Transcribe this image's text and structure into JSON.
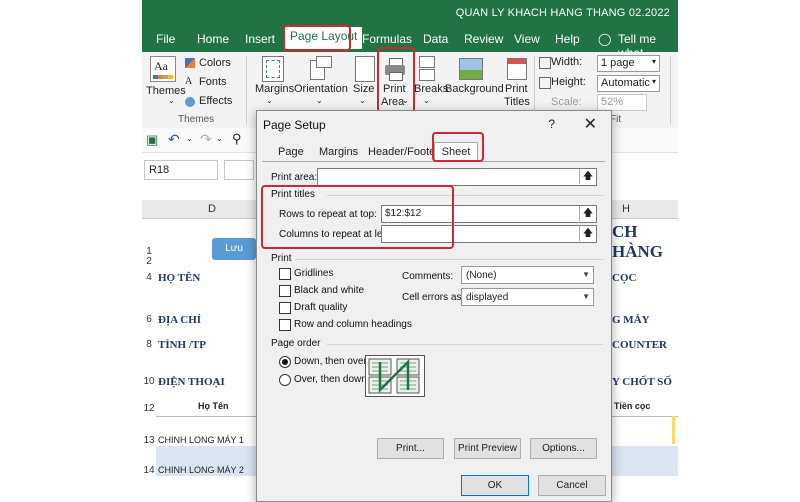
{
  "window": {
    "title": "QUAN LY KHACH HANG THANG 02.2022"
  },
  "ribbon": {
    "tabs": [
      "File",
      "Home",
      "Insert",
      "Page Layout",
      "Formulas",
      "Data",
      "Review",
      "View",
      "Help"
    ],
    "active_tab": "Page Layout",
    "tell_me": "Tell me what",
    "themes_group": {
      "themes": "Themes",
      "colors": "Colors",
      "fonts": "Fonts",
      "effects": "Effects",
      "group_label": "Themes"
    },
    "page_setup_group": {
      "margins": "Margins",
      "orientation": "Orientation",
      "size": "Size",
      "print_area_1": "Print",
      "print_area_2": "Area",
      "breaks": "Breaks",
      "background": "Background",
      "print_titles_1": "Print",
      "print_titles_2": "Titles"
    },
    "scale_group": {
      "width_label": "Width:",
      "width_value": "1 page",
      "height_label": "Height:",
      "height_value": "Automatic",
      "scale_label": "Scale:",
      "scale_value": "52%",
      "group_label_fragment": "Fit"
    }
  },
  "formula_bar": {
    "name_box": "R18"
  },
  "sheet": {
    "col_left": "D",
    "col_right": "H",
    "button": "Lưu",
    "rows": [
      "1",
      "2",
      "4",
      "6",
      "8",
      "10",
      "12",
      "13",
      "14"
    ],
    "left_cells": [
      "HỌ TÊN",
      "ĐỊA CHỈ",
      "TỈNH /TP",
      "ĐIỆN THOẠI"
    ],
    "right_cells": [
      "CH HÀNG",
      "CỌC",
      "G MÁY",
      "COUNTER",
      "Y CHỐT SỐ"
    ],
    "header_left": "Họ Tên",
    "header_right": "Tiền cọc",
    "data_rows": [
      "CHINH LONG MÁY 1",
      "CHINH LONG MÁY 2"
    ]
  },
  "dialog": {
    "title": "Page Setup",
    "help": "?",
    "close": "✕",
    "tabs": [
      "Page",
      "Margins",
      "Header/Footer",
      "Sheet"
    ],
    "active_tab": "Sheet",
    "print_area_label": "Print area:",
    "print_area_value": "",
    "print_titles_label": "Print titles",
    "rows_repeat_label": "Rows to repeat at top:",
    "rows_repeat_value": "$12:$12",
    "cols_repeat_label": "Columns to repeat at left:",
    "cols_repeat_value": "",
    "print_label": "Print",
    "checkboxes": [
      "Gridlines",
      "Black and white",
      "Draft quality",
      "Row and column headings"
    ],
    "comments_label": "Comments:",
    "comments_value": "(None)",
    "cell_errors_label": "Cell errors as:",
    "cell_errors_value": "displayed",
    "page_order_label": "Page order",
    "page_order_options": [
      "Down, then over",
      "Over, then down"
    ],
    "page_order_selected": "Down, then over",
    "buttons": {
      "print": "Print...",
      "print_preview": "Print Preview",
      "options": "Options...",
      "ok": "OK",
      "cancel": "Cancel"
    }
  },
  "colors": {
    "excel_green": "#217346",
    "highlight_red": "#d12636",
    "sheet_blue_text": "#1f3864",
    "lưu_button": "#5b9bd5"
  }
}
